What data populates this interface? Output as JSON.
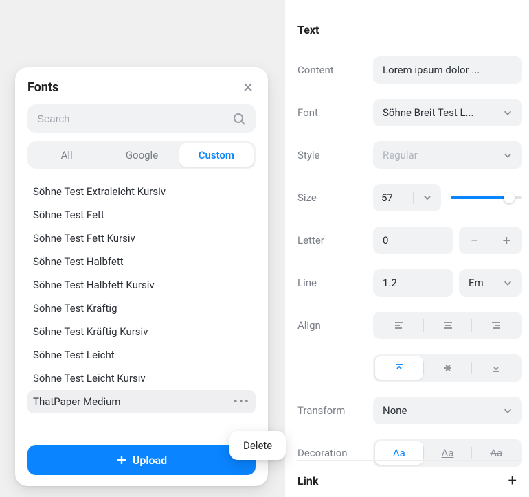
{
  "right": {
    "section_title": "Text",
    "labels": {
      "content": "Content",
      "font": "Font",
      "style": "Style",
      "size": "Size",
      "letter": "Letter",
      "line": "Line",
      "align": "Align",
      "transform": "Transform",
      "decoration": "Decoration",
      "link": "Link"
    },
    "values": {
      "content": "Lorem ipsum dolor ...",
      "font": "Söhne Breit Test L...",
      "style": "Regular",
      "size": "57",
      "letter": "0",
      "line_value": "1.2",
      "line_unit": "Em",
      "transform": "None",
      "deco_label": "Aa"
    },
    "icons": {
      "plus": "+"
    }
  },
  "fonts": {
    "title": "Fonts",
    "search_placeholder": "Search",
    "tabs": {
      "all": "All",
      "google": "Google",
      "custom": "Custom"
    },
    "list": [
      "Söhne Test Extraleicht Kursiv",
      "Söhne Test Fett",
      "Söhne Test Fett Kursiv",
      "Söhne Test Halbfett",
      "Söhne Test Halbfett Kursiv",
      "Söhne Test Kräftig",
      "Söhne Test Kräftig Kursiv",
      "Söhne Test Leicht",
      "Söhne Test Leicht Kursiv",
      "ThatPaper Medium"
    ],
    "upload": "Upload",
    "context_delete": "Delete"
  }
}
